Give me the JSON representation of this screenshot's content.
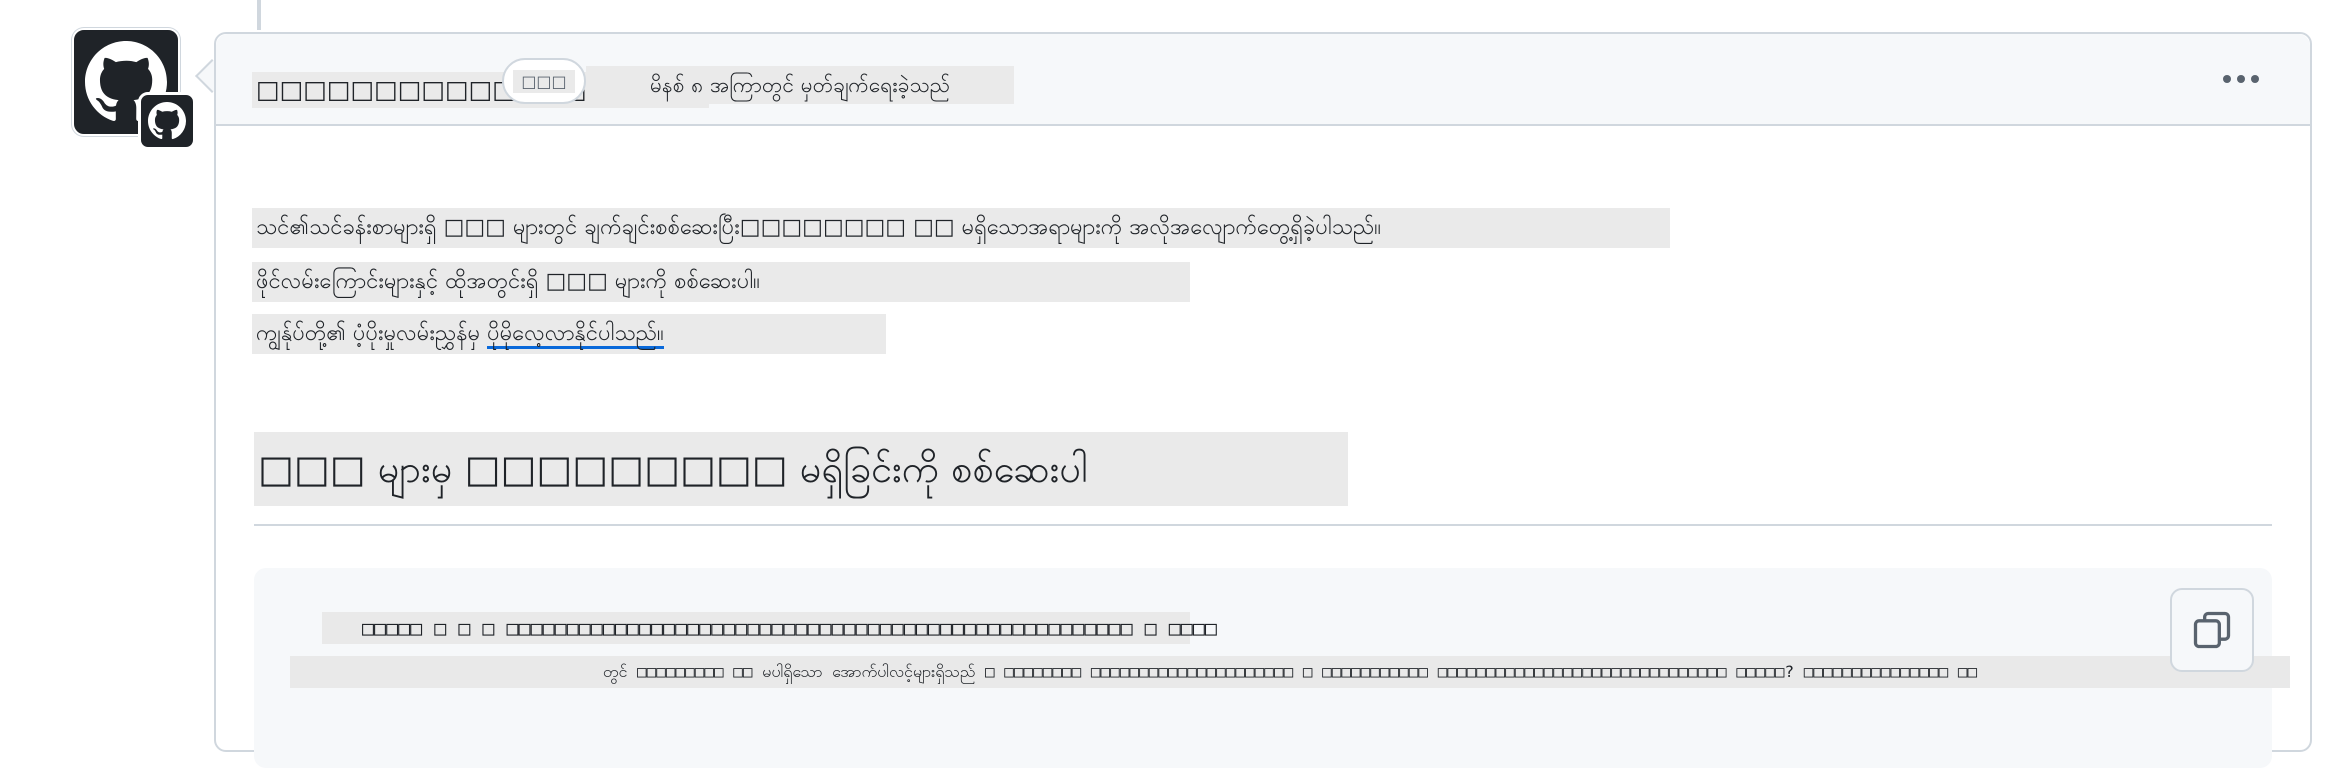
{
  "comment": {
    "author": "□□□□□□□□□□□□□□□□□□□",
    "role_badge": "□□□",
    "timestamp": "မိနစ် ၈ အကြာတွင် မှတ်ချက်ရေးခဲ့သည်",
    "more_label": "Show options"
  },
  "body": {
    "para1": "သင်၏သင်ခန်းစာများရှိ □□□ များတွင် ချက်ချင်းစစ်ဆေးပြီး□□□□□□□□ □□ မရှိသောအရာများကို အလိုအလျောက်တွေ့ရှိခဲ့ပါသည်။",
    "para2": "ဖိုင်လမ်းကြောင်းများနှင့် ထိုအတွင်းရှိ □□□ များကို စစ်ဆေးပါ။",
    "para3_prefix": "ကျွန်ုပ်တို့၏ ပံ့ပိုးမှုလမ်းညွှန်မှ ",
    "para3_link": "ပိုမိုလေ့လာနိုင်ပါသည်။"
  },
  "heading": "□□□ များမှ □□□□□□□□□ မရှိခြင်းကို စစ်ဆေးပါ",
  "code": {
    "line1": "□□□□□ □ □ □ □□□□□□□□□□□□□□□□□□□□□□□□□□□□□□□□□□□□□□□□□□□□□□□□□□□□ □ □□□□",
    "line2": "တွင် □□□□□□□□□ □□ မပါရှိသော အောက်ပါလင့်များရှိသည် □ □□□□□□□□ □□□□□□□□□□□□□□□□□□□□□ □ □□□□□□□□□□□ □□□□□□□□□□□□□□□□□□□□□□□□□□□□□□ □□□□□? □□□□□□□□□□□□□□□ □□",
    "copy_label": "Copy"
  }
}
